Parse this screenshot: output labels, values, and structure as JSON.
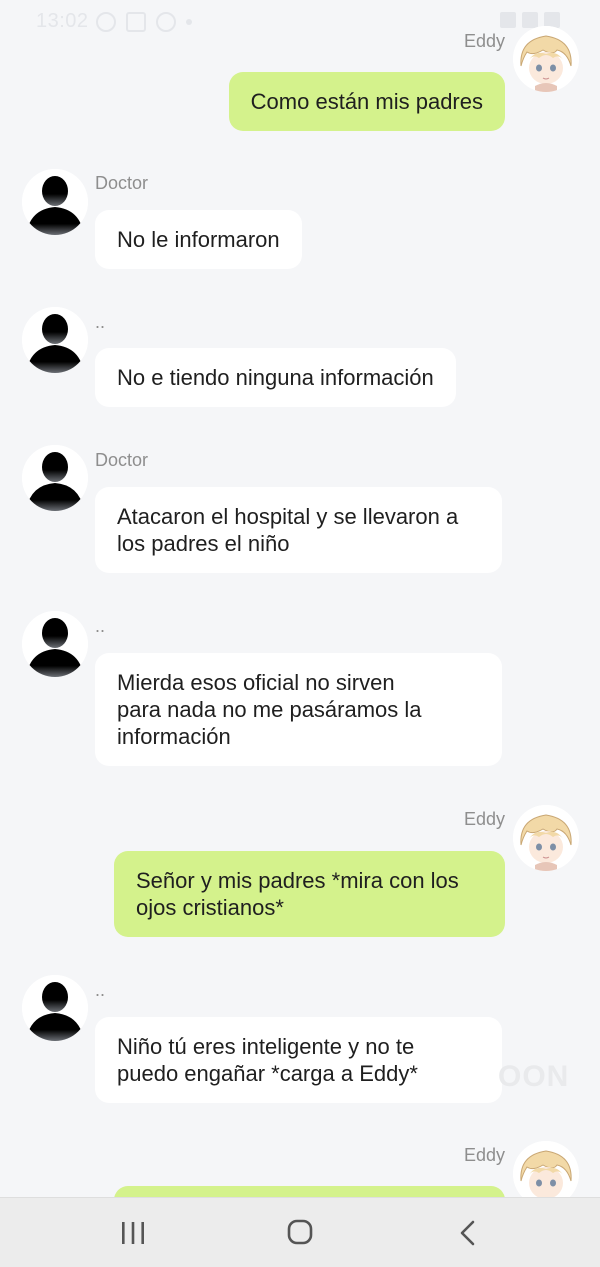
{
  "status": {
    "time": "13:02"
  },
  "messages": [
    {
      "sender": "Eddy",
      "side": "out",
      "text": "Como están mis padres"
    },
    {
      "sender": "Doctor",
      "side": "in",
      "text": "No le informaron"
    },
    {
      "sender": "..",
      "side": "in",
      "text": "No e tiendo ninguna información"
    },
    {
      "sender": "Doctor",
      "side": "in",
      "text": "Atacaron el hospital y se llevaron a\nlos padres el niño"
    },
    {
      "sender": "..",
      "side": "in",
      "text": "Mierda esos oficial no sirven\npara nada no me pasáramos la\ninformación"
    },
    {
      "sender": "Eddy",
      "side": "out",
      "text": "Señor y mis padres *mira con los\nojos cristianos*"
    },
    {
      "sender": "..",
      "side": "in",
      "text": "Niño tú eres inteligente y no te\npuedo engañar *carga a Eddy*"
    },
    {
      "sender": "Eddy",
      "side": "out",
      "text": ""
    }
  ],
  "watermark": "OON",
  "nav": {
    "recent_icon": "recent-apps-icon",
    "home_icon": "home-icon",
    "back_icon": "back-icon"
  },
  "colors": {
    "out_bubble": "#d4f28c",
    "in_bubble": "#ffffff",
    "background": "#f5f6f8"
  }
}
